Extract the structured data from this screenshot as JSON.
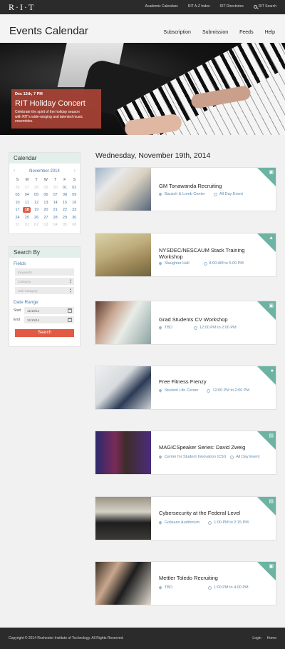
{
  "topbar": {
    "logo": "R·I·T",
    "links": [
      "Academic Calendars",
      "RIT A-Z Index",
      "RIT Directories"
    ],
    "search_label": "RIT Search"
  },
  "header": {
    "title": "Events Calendar",
    "nav": [
      "Subscription",
      "Submission",
      "Feeds",
      "Help"
    ]
  },
  "hero": {
    "date": "Dec 13th, 7 PM",
    "title": "RIT Holiday Concert",
    "description": "Celebrate the spirit of the holiday season with RIT's wide-ranging and talented music ensembles."
  },
  "calendar": {
    "heading": "Calendar",
    "month": "November 2014",
    "prev": "‹",
    "next": "›",
    "weekdays": [
      "S",
      "M",
      "T",
      "W",
      "T",
      "F",
      "S"
    ],
    "days": [
      "26",
      "27",
      "28",
      "29",
      "30",
      "01",
      "02",
      "03",
      "04",
      "05",
      "06",
      "07",
      "08",
      "09",
      "10",
      "11",
      "12",
      "13",
      "14",
      "15",
      "16",
      "17",
      "18",
      "19",
      "20",
      "21",
      "22",
      "23",
      "24",
      "25",
      "26",
      "27",
      "28",
      "29",
      "30",
      "31",
      "01",
      "02",
      "03",
      "04",
      "05",
      "06"
    ],
    "selected": "18"
  },
  "search": {
    "heading": "Search By",
    "fields_label": "Fields",
    "keywords_placeholder": "Keywords",
    "category_placeholder": "Category",
    "subcategory_placeholder": "Sub-Category",
    "date_range_label": "Date Range",
    "start_label": "Start",
    "start_value": "11/19/14",
    "end_label": "End",
    "end_value": "11/19/14",
    "button": "Search"
  },
  "events_heading": "Wednesday, November 19th, 2014",
  "events": [
    {
      "title": "GM Tonawanda Recruiting",
      "location": "Bausch & Lomb Center",
      "time": "All Day Event",
      "icon": "briefcase-icon"
    },
    {
      "title": "NYSDEC/NESCAUM Stack Training Workshop",
      "location": "Slaughter Hall",
      "time": "8:00 AM to 5:00 PM",
      "icon": "graduation-cap-icon"
    },
    {
      "title": "Grad Students CV Workshop",
      "location": "TBD",
      "time": "12:00 PM to 2:00 PM",
      "icon": "briefcase-icon"
    },
    {
      "title": "Free Fitness Frenzy",
      "location": "Student Life Center",
      "time": "12:00 PM to 2:00 PM",
      "icon": "ball-icon"
    },
    {
      "title": "MAGICSpeaker Series: David Zweig",
      "location": "Center for Student Innovation (CSI)",
      "time": "All Day Event",
      "icon": "podium-icon"
    },
    {
      "title": "Cybersecurity at the Federal Level",
      "location": "Golisano Auditorium",
      "time": "1:00 PM to 2:15 PM",
      "icon": "podium-icon"
    },
    {
      "title": "Mettler Toledo Recruiting",
      "location": "TBD",
      "time": "1:00 PM to 4:00 PM",
      "icon": "briefcase-icon"
    }
  ],
  "footer": {
    "copyright": "Copyright © 2014 Rochester Institute of Technology. All Rights Reserved.",
    "links": [
      "Login",
      "Home"
    ]
  },
  "colors": {
    "accent": "#e15a44",
    "teal": "#6db3a3",
    "link": "#5d8bb3",
    "topbar": "#2b2b2b"
  }
}
